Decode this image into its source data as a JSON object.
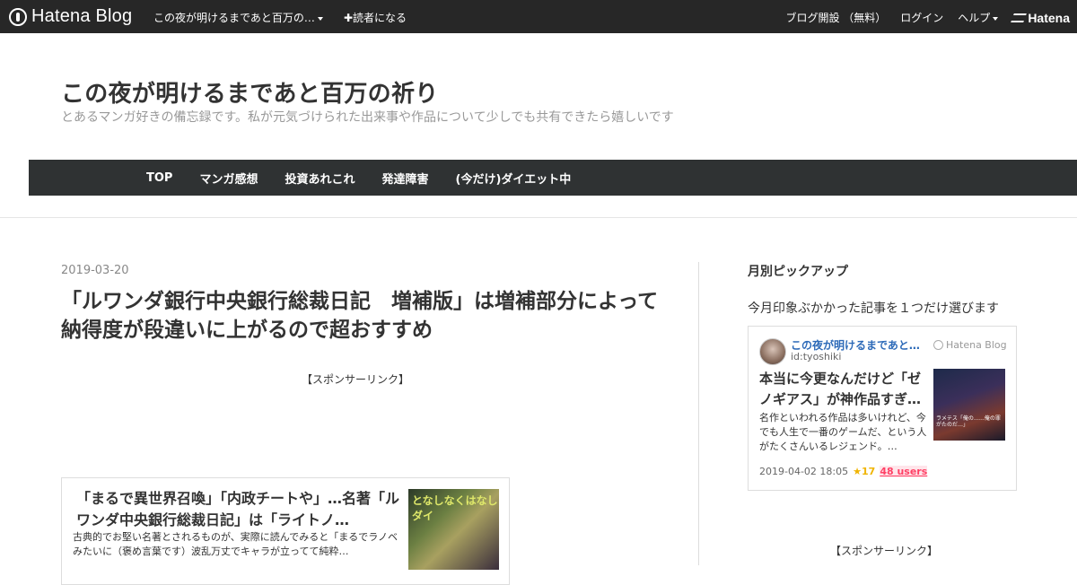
{
  "topbar": {
    "logo_text": "Hatena Blog",
    "blog_name": "この夜が明けるまであと百万の…",
    "reader_label": "✚読者になる",
    "right_links": [
      "ブログ開設 （無料）",
      "ログイン",
      "ヘルプ"
    ],
    "hatena_label": "Hatena"
  },
  "header": {
    "title": "この夜が明けるまであと百万の祈り",
    "description": "とあるマンガ好きの備忘録です。私が元気づけられた出来事や作品について少しでも共有できたら嬉しいです"
  },
  "nav": {
    "items": [
      "TOP",
      "マンガ感想",
      "投資あれこれ",
      "発達障害",
      "(今だけ)ダイエット中"
    ]
  },
  "article": {
    "date": "2019-03-20",
    "title": "「ルワンダ銀行中央銀行総裁日記　増補版」は増補部分によって納得度が段違いに上がるので超おすすめ",
    "sponsor": "【スポンサーリンク】",
    "embed": {
      "title": "「まるで異世界召喚」「内政チートや」…名著「ルワンダ中央銀行総裁日記」は「ライトノ…",
      "description": "古典的でお堅い名著とされるものが、実際に読んでみると「まるでラノベみたいに（褒め言葉です）波乱万丈でキャラが立ってて純粋…",
      "thumb_text": "となしなくはなしダイ"
    }
  },
  "sidebar": {
    "heading": "月別ピックアップ",
    "text": "今月印象ぶかかった記事を１つだけ選びます",
    "card": {
      "blog_name": "この夜が明けるまであと…",
      "user_id": "id:tyoshiki",
      "brand": "Hatena Blog",
      "title": "本当に今更なんだけど「ゼノギアス」が神作品すぎ…",
      "description": "名作といわれる作品は多いけれど、今でも人生で一番のゲームだ、という人がたくさんいるレジェンド。…",
      "thumb_text": "ラメテス「俺の……俺の罪がたのだ…」",
      "datetime": "2019-04-02 18:05",
      "stars": "17",
      "users": "48 users"
    },
    "sponsor": "【スポンサーリンク】"
  }
}
